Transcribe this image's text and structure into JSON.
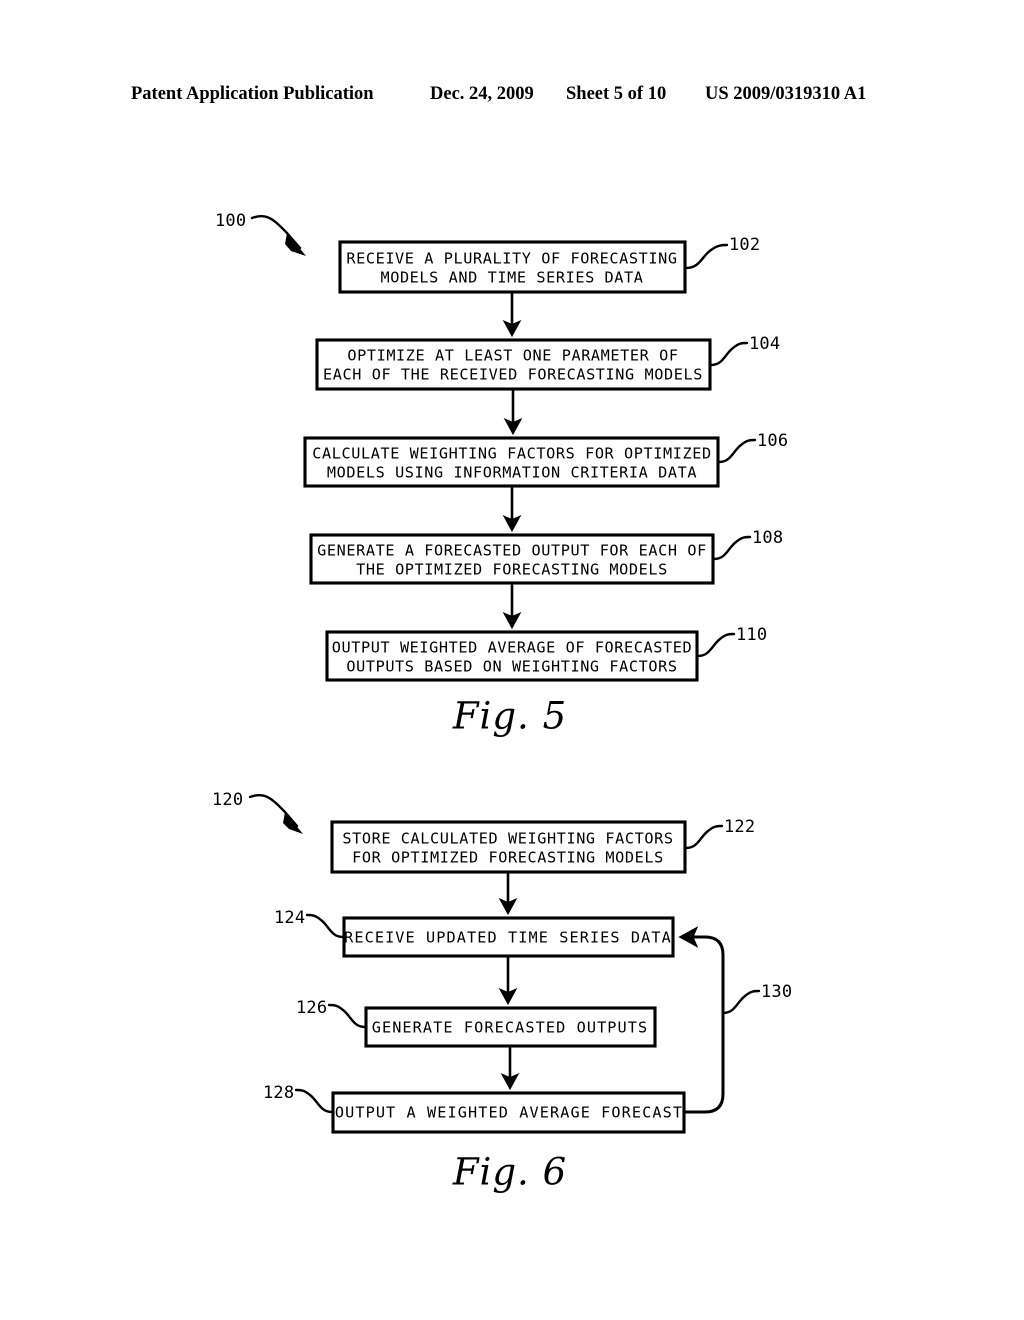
{
  "header": {
    "publication": "Patent Application Publication",
    "date": "Dec. 24, 2009",
    "sheet": "Sheet 5 of 10",
    "patent_number": "US 2009/0319310 A1"
  },
  "figures": [
    {
      "caption": "Fig. 5",
      "diagram_ref": "100",
      "steps": [
        {
          "ref": "102",
          "line1": "RECEIVE A PLURALITY OF FORECASTING",
          "line2": "MODELS AND TIME SERIES DATA"
        },
        {
          "ref": "104",
          "line1": "OPTIMIZE AT LEAST ONE PARAMETER OF",
          "line2": "EACH OF THE RECEIVED FORECASTING MODELS"
        },
        {
          "ref": "106",
          "line1": "CALCULATE WEIGHTING FACTORS FOR OPTIMIZED",
          "line2": "MODELS USING INFORMATION CRITERIA DATA"
        },
        {
          "ref": "108",
          "line1": "GENERATE A FORECASTED OUTPUT FOR EACH OF",
          "line2": "THE OPTIMIZED FORECASTING MODELS"
        },
        {
          "ref": "110",
          "line1": "OUTPUT WEIGHTED AVERAGE OF FORECASTED",
          "line2": "OUTPUTS BASED ON WEIGHTING FACTORS"
        }
      ]
    },
    {
      "caption": "Fig. 6",
      "diagram_ref": "120",
      "feedback_ref": "130",
      "steps": [
        {
          "ref": "122",
          "line1": "STORE CALCULATED WEIGHTING FACTORS",
          "line2": "FOR OPTIMIZED FORECASTING MODELS"
        },
        {
          "ref": "124",
          "line1": "RECEIVE UPDATED TIME SERIES DATA",
          "line2": ""
        },
        {
          "ref": "126",
          "line1": "GENERATE FORECASTED OUTPUTS",
          "line2": ""
        },
        {
          "ref": "128",
          "line1": "OUTPUT A WEIGHTED AVERAGE FORECAST",
          "line2": ""
        }
      ]
    }
  ]
}
